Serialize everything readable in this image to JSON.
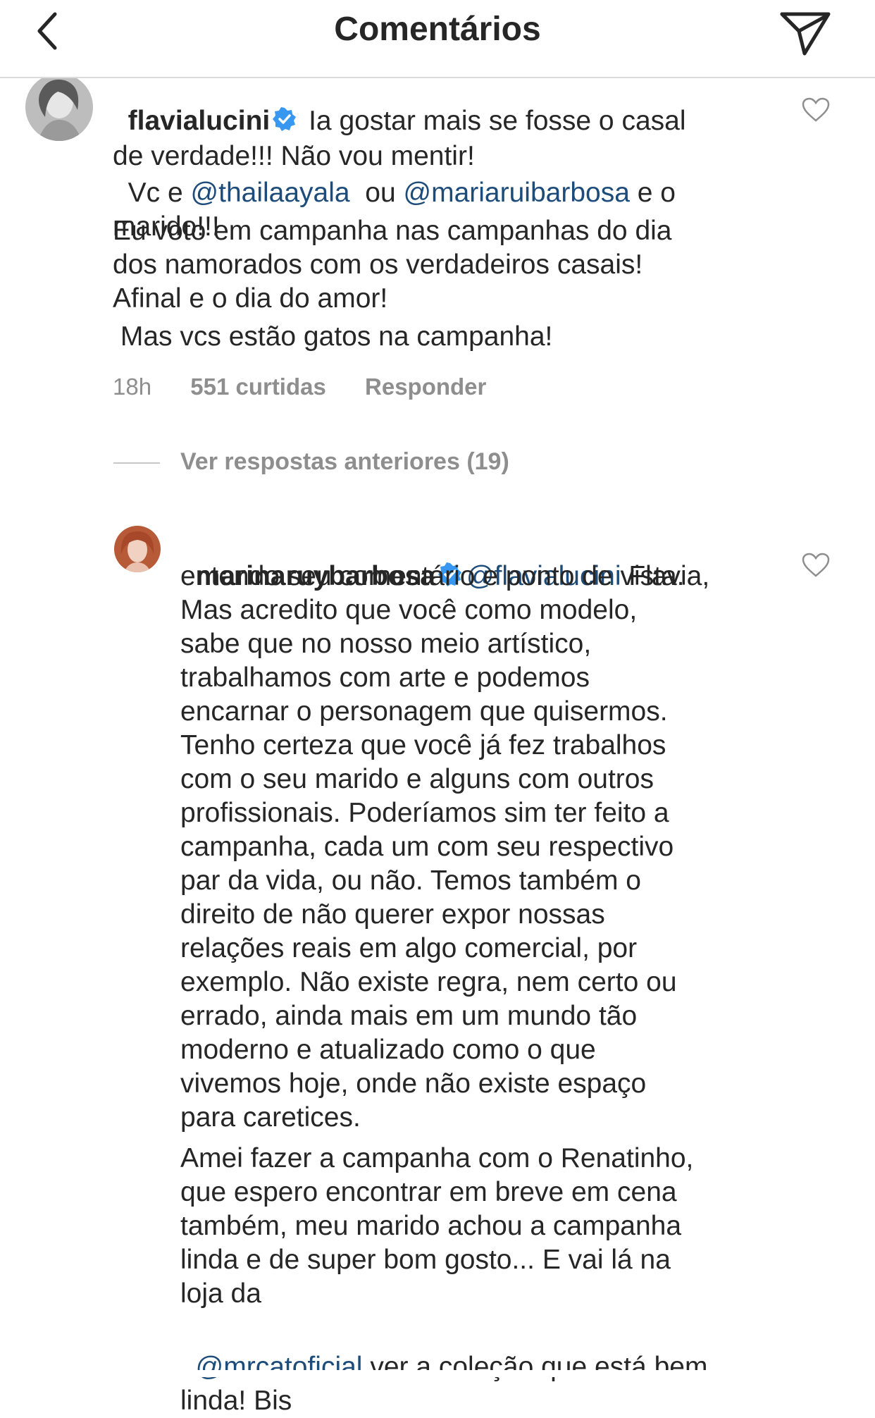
{
  "header": {
    "title": "Comentários"
  },
  "comments": [
    {
      "username": "flavialucini",
      "text_lines": [
        " Ia gostar mais se fosse o casal",
        "de verdade!!! Não vou mentir!"
      ],
      "line3_prefix": "Vc e ",
      "mention1": "@thailaayala",
      "line3_mid": "  ou ",
      "mention2": "@mariaruibarbosa",
      "line3_suffix": " e o",
      "line4": "marido!!!",
      "paragraph2": "Eu voto em campanha nas campanhas do dia\ndos namorados com os verdadeiros casais!\nAfinal e o dia do amor!",
      "paragraph3": " Mas vcs estão gatos na campanha!",
      "time": "18h",
      "likes": "551 curtidas",
      "reply": "Responder"
    }
  ],
  "view_replies": "Ver respostas anteriores (19)",
  "reply": {
    "username": "marinaruybarbosa",
    "mention": "@flavialucini",
    "first_line_rest": " Flavia,",
    "paragraph1": "entendo seu comentário e ponto de vista.\nMas acredito que você como modelo,\nsabe que no nosso meio artístico,\ntrabalhamos com arte e podemos\nencarnar o personagem que quisermos.\nTenho certeza que você já fez trabalhos\ncom o seu marido e alguns com outros\nprofissionais. Poderíamos sim ter feito a\ncampanha, cada um com seu respectivo\npar da vida, ou não. Temos também o\ndireito de não querer expor nossas\nrelações reais em algo comercial, por\nexemplo. Não existe regra, nem certo ou\nerrado, ainda mais em um mundo tão\nmoderno e atualizado como o que\nvivemos hoje, onde não existe espaço\npara caretices.",
    "paragraph2": "Amei fazer a campanha com o Renatinho,\nque espero encontrar em breve em cena\ntambém, meu marido achou a campanha\nlinda e de super bom gosto... E vai lá na\nloja da",
    "mention_store": "@mrcatoficial",
    "last_line_rest": " ver a coleção que está bem",
    "cut_line": "linda! Bis"
  },
  "colors": {
    "text": "#262626",
    "mention": "#1d4c7a",
    "meta": "#8e8e8e",
    "verified": "#3897f0"
  },
  "icons": [
    "back-chevron-icon",
    "send-direct-icon",
    "verified-badge-icon",
    "heart-outline-icon"
  ]
}
